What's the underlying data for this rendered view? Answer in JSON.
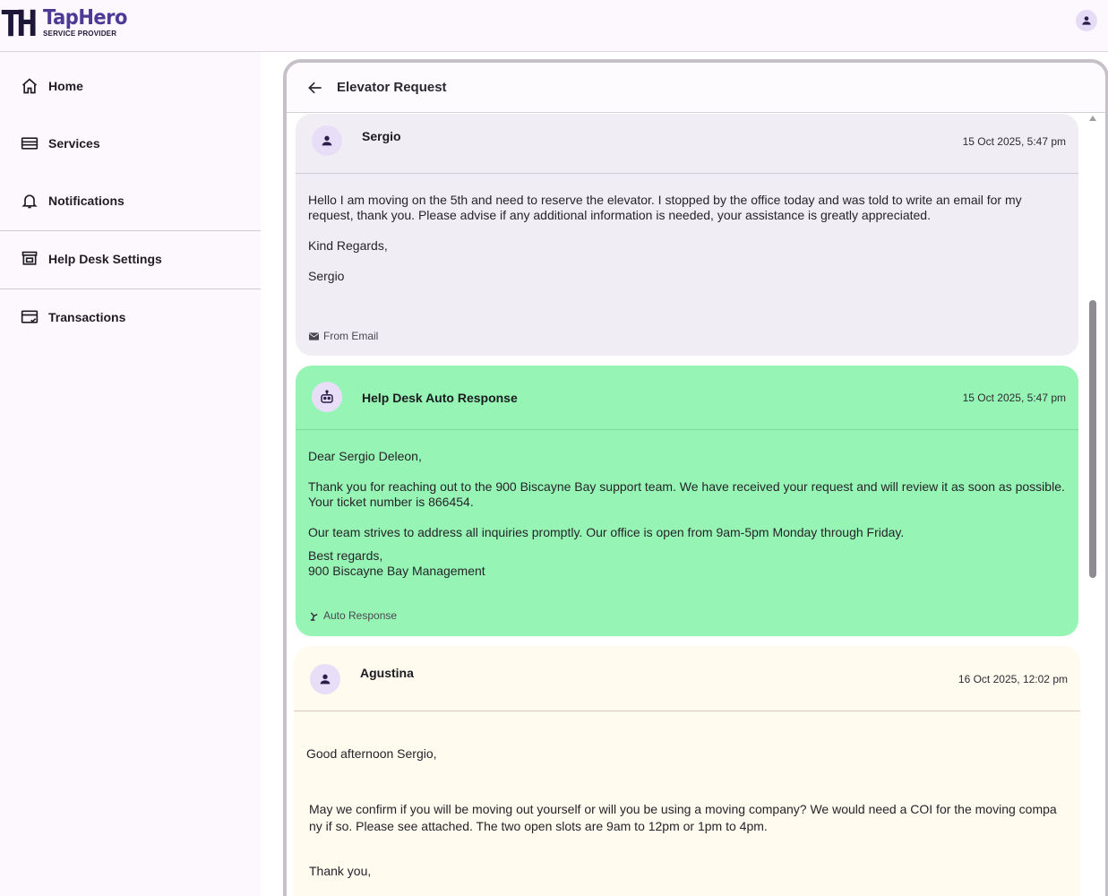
{
  "app": {
    "logo_mark": "TH",
    "logo_name": "TapHero",
    "logo_subtitle": "SERVICE PROVIDER"
  },
  "sidebar": {
    "items": [
      {
        "label": "Home",
        "icon": "home-icon"
      },
      {
        "label": "Services",
        "icon": "services-icon"
      },
      {
        "label": "Notifications",
        "icon": "bell-icon"
      },
      {
        "label": "Help Desk Settings",
        "icon": "storefront-icon"
      },
      {
        "label": "Transactions",
        "icon": "credit-card-check-icon"
      }
    ]
  },
  "ticket": {
    "title": "Elevator Request"
  },
  "messages": [
    {
      "sender": "Sergio",
      "time": "15 Oct 2025, 5:47 pm",
      "paragraphs": [
        "Hello I am moving on the 5th and need to reserve the elevator. I stopped by the office today and was told to write an email for my request, thank you. Please advise if any additional information is needed, your assistance is greatly appreciated.",
        "Kind Regards,",
        "Sergio"
      ],
      "source": "From Email",
      "source_icon": "email-icon",
      "background": "#f1edf5"
    },
    {
      "sender": "Help Desk Auto Response",
      "time": "15 Oct 2025, 5:47 pm",
      "paragraphs": [
        "Dear Sergio Deleon,",
        "Thank you for reaching out to the 900 Biscayne Bay support team. We have received your request and will review it as soon as possible. Your ticket number is 866454.",
        "Our team strives to address all inquiries promptly. Our office is open from 9am-5pm Monday through Friday.",
        "Best regards,",
        "900 Biscayne Bay Management"
      ],
      "source": "Auto Response",
      "source_icon": "robot-arm-icon",
      "background": "#96f5b4"
    },
    {
      "sender": "Agustina",
      "time": "16 Oct 2025, 12:02 pm",
      "paragraphs": [
        "Good afternoon Sergio,",
        "May we confirm if you will be moving out yourself or will you be using a moving company? We would need a COI for the moving compa ny if so. Please see attached. The two open slots are 9am to 12pm or 1pm to 4pm.",
        "Thank you,"
      ],
      "background": "#fffbef"
    }
  ]
}
